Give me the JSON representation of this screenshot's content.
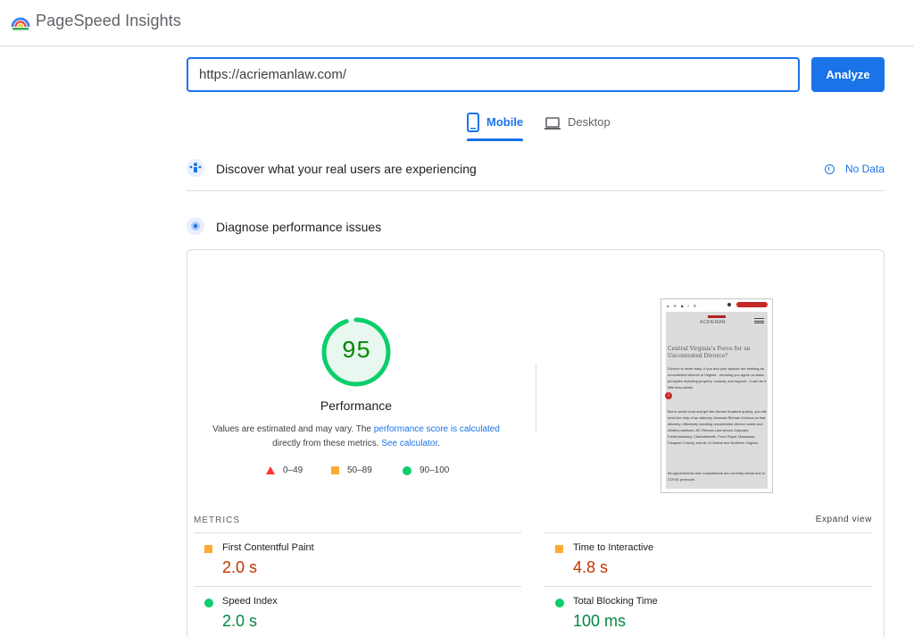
{
  "app": {
    "title": "PageSpeed Insights"
  },
  "search": {
    "url": "https://acriemanlaw.com/",
    "analyze_label": "Analyze"
  },
  "tabs": [
    {
      "label": "Mobile",
      "selected": true,
      "icon": "smartphone-icon"
    },
    {
      "label": "Desktop",
      "selected": false,
      "icon": "laptop-icon"
    }
  ],
  "field_data": {
    "title": "Discover what your real users are experiencing",
    "status": "No Data"
  },
  "lab_data": {
    "title": "Diagnose performance issues"
  },
  "performance": {
    "score": "95",
    "score_fraction": 0.95,
    "label": "Performance",
    "note_prefix": "Values are estimated and may vary. The ",
    "note_link1": "performance score is calculated",
    "note_middle": " directly from these metrics. ",
    "note_link2": "See calculator",
    "note_suffix": "."
  },
  "legend": [
    {
      "range": "0–49",
      "rating": "fail"
    },
    {
      "range": "50–89",
      "rating": "average"
    },
    {
      "range": "90–100",
      "rating": "pass"
    }
  ],
  "screenshot": {
    "brand": "ACRIEMAN",
    "heading": "Central Virginia's Force for an Uncontested Divorce?",
    "p1": "Divorce is never easy. If you and your spouse are seeking an uncontested divorce in Virginia - meaning you agree on basic principles including property, custody, and support - it can be a little less painful.",
    "p2": "But to avoid court and get the divorce finalized quickly, you will need the help of an attorney. Amanda Rieman Johnson is that attorney, effectively handling uncontested divorce cases and related practices. AC Rieman Law serves Culpeper, Fredericksburg, Charlottesville, Front Royal, Manassas, Fauquier County, and all of Central and Northern Virginia.",
    "p3": "All appointments and consultations are currently virtual due to COVID protocols."
  },
  "metrics": {
    "heading": "METRICS",
    "expand_label": "Expand view",
    "items": [
      {
        "name": "First Contentful Paint",
        "value": "2.0 s",
        "rating": "average"
      },
      {
        "name": "Time to Interactive",
        "value": "4.8 s",
        "rating": "average"
      },
      {
        "name": "Speed Index",
        "value": "2.0 s",
        "rating": "pass"
      },
      {
        "name": "Total Blocking Time",
        "value": "100 ms",
        "rating": "pass"
      }
    ]
  },
  "colors": {
    "accent": "#1a73e8",
    "pass": "#0cce6b",
    "average": "#ffaa33",
    "fail": "#ff3333"
  }
}
